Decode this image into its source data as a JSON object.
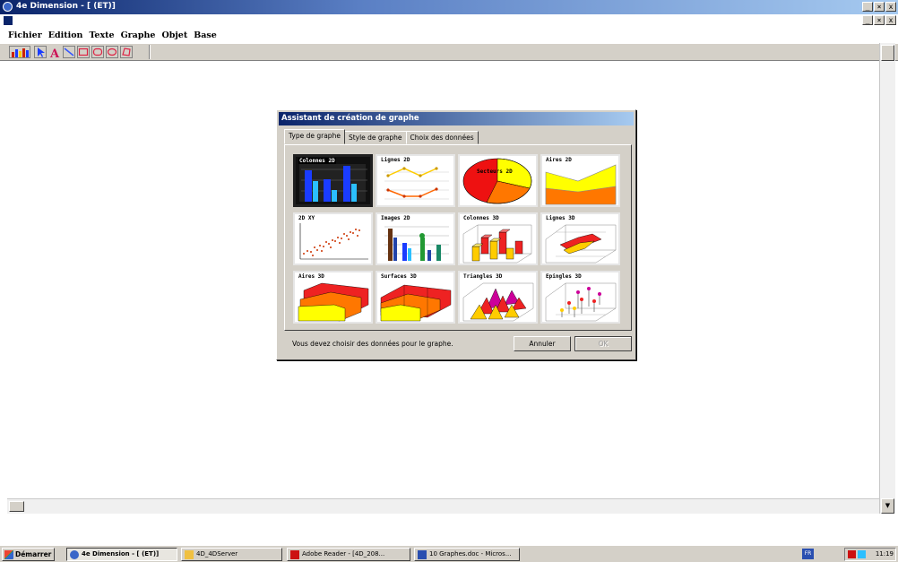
{
  "window": {
    "title": "4e Dimension - [ (ET)]",
    "child_title": "",
    "controls": {
      "minimize": "_",
      "restore": "×",
      "close": "x"
    }
  },
  "menu": [
    {
      "name": "fichier",
      "label": "Fichier"
    },
    {
      "name": "edition",
      "label": "Edition"
    },
    {
      "name": "texte",
      "label": "Texte"
    },
    {
      "name": "graphe",
      "label": "Graphe"
    },
    {
      "name": "objet",
      "label": "Objet"
    },
    {
      "name": "base",
      "label": "Base"
    }
  ],
  "toolbar": {
    "tools": [
      "chart-icon",
      "arrow-icon",
      "text-icon",
      "line-icon",
      "rectangle-icon",
      "rounded-rect-icon",
      "oval-icon",
      "polygon-icon"
    ]
  },
  "dialog": {
    "title": "Assistant de création de graphe",
    "tabs": [
      "Type de graphe",
      "Style de graphe",
      "Choix des données"
    ],
    "active_tab": 0,
    "chart_types": [
      {
        "label": "Colonnes 2D",
        "icon": "columns-2d-icon",
        "selected": true
      },
      {
        "label": "Lignes 2D",
        "icon": "lines-2d-icon"
      },
      {
        "label": "Secteurs 2D",
        "icon": "pie-2d-icon"
      },
      {
        "label": "Aires 2D",
        "icon": "area-2d-icon"
      },
      {
        "label": "2D XY",
        "icon": "scatter-2d-icon"
      },
      {
        "label": "Images 2D",
        "icon": "pictures-2d-icon"
      },
      {
        "label": "Colonnes 3D",
        "icon": "columns-3d-icon"
      },
      {
        "label": "Lignes 3D",
        "icon": "lines-3d-icon"
      },
      {
        "label": "Aires 3D",
        "icon": "area-3d-icon"
      },
      {
        "label": "Surfaces 3D",
        "icon": "surface-3d-icon"
      },
      {
        "label": "Triangles 3D",
        "icon": "triangles-3d-icon"
      },
      {
        "label": "Epingles 3D",
        "icon": "pins-3d-icon"
      }
    ],
    "status_text": "Vous devez choisir des données pour le graphe.",
    "cancel_label": "Annuler",
    "ok_label": "OK"
  },
  "taskbar": {
    "start_label": "Démarrer",
    "items": [
      {
        "label": "4e Dimension - [ (ET)]",
        "active": true
      },
      {
        "label": "4D_4DServer",
        "active": false
      },
      {
        "label": "Adobe Reader - [4D_208...",
        "active": false
      },
      {
        "label": "10 Graphes.doc - Micros...",
        "active": false
      }
    ],
    "lang": "FR",
    "clock": "11:19"
  },
  "colors": {
    "blue": "#1a3cff",
    "cyan": "#2bbfff",
    "yellow": "#ffff00",
    "orange": "#ff8800",
    "red": "#ee1111",
    "title_blue": "#0a246a"
  }
}
